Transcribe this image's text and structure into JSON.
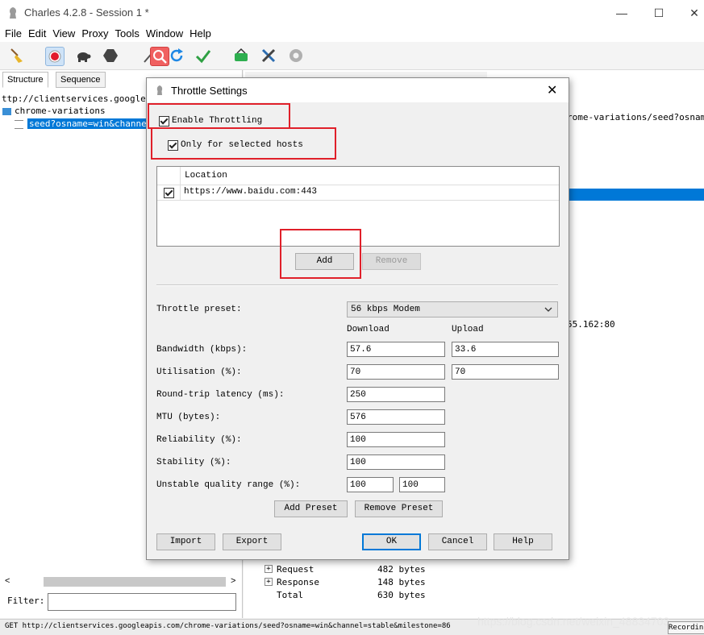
{
  "app": {
    "title": "Charles 4.2.8 - Session 1 *",
    "menu": [
      "File",
      "Edit",
      "View",
      "Proxy",
      "Tools",
      "Window",
      "Help"
    ],
    "toolbar": [
      "broom-icon",
      "record-icon",
      "turtle-icon",
      "stop-hexagon-icon",
      "search-magnifier-icon",
      "refresh-icon",
      "check-icon",
      "basket-icon",
      "tools-icon",
      "gear-icon"
    ]
  },
  "left": {
    "tabs": [
      "Structure",
      "Sequence"
    ],
    "tree": [
      "ttp://clientservices.googleapi",
      "chrome-variations",
      "seed?osname=win&channel="
    ],
    "filter_label": "Filter:",
    "filter_value": ""
  },
  "right": {
    "overview_text": "rome-variations/seed?osnam...",
    "ip_text": "55.162:80",
    "size_rows": [
      {
        "label": "Request",
        "value": "482 bytes"
      },
      {
        "label": "Response",
        "value": "148 bytes"
      },
      {
        "label": "Total",
        "value": "630 bytes"
      }
    ]
  },
  "status": {
    "text": "GET http://clientservices.googleapis.com/chrome-variations/seed?osname=win&channel=stable&milestone=86",
    "watermark": "https://blog.csdn.net/weixin_48834703",
    "recording": "Recordin"
  },
  "dialog": {
    "title": "Throttle Settings",
    "enable_throttling": {
      "label": "Enable Throttling",
      "checked": true
    },
    "only_selected_hosts": {
      "label": "Only for selected hosts",
      "checked": true
    },
    "locations": {
      "header": "Location",
      "rows": [
        {
          "checked": true,
          "value": "https://www.baidu.com:443"
        }
      ]
    },
    "add_label": "Add",
    "remove_label": "Remove",
    "preset_label": "Throttle preset:",
    "preset_value": "56 kbps Modem",
    "download_header": "Download",
    "upload_header": "Upload",
    "fields": {
      "bandwidth": {
        "label": "Bandwidth (kbps):",
        "download": "57.6",
        "upload": "33.6"
      },
      "utilisation": {
        "label": "Utilisation (%):",
        "download": "70",
        "upload": "70"
      },
      "latency": {
        "label": "Round-trip latency (ms):",
        "value": "250"
      },
      "mtu": {
        "label": "MTU (bytes):",
        "value": "576"
      },
      "reliability": {
        "label": "Reliability (%):",
        "value": "100"
      },
      "stability": {
        "label": "Stability (%):",
        "value": "100"
      },
      "unstable": {
        "label": "Unstable quality range (%):",
        "from": "100",
        "to": "100"
      }
    },
    "add_preset_label": "Add Preset",
    "remove_preset_label": "Remove Preset",
    "import_label": "Import",
    "export_label": "Export",
    "ok_label": "OK",
    "cancel_label": "Cancel",
    "help_label": "Help"
  },
  "colors": {
    "highlight": "#e0202a",
    "selection": "#0078d7",
    "accent": "#0078d7"
  }
}
